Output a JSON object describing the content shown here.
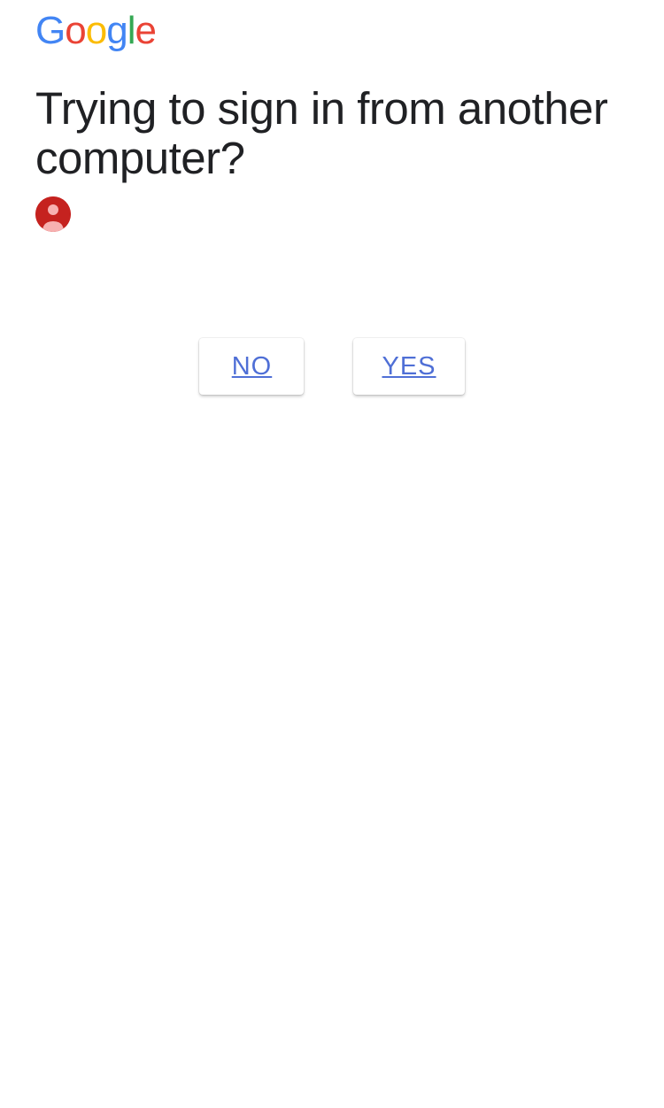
{
  "logo": {
    "g1": "G",
    "o1": "o",
    "o2": "o",
    "g2": "g",
    "l": "l",
    "e": "e"
  },
  "heading": "Trying to sign in from another computer?",
  "account": {
    "email": ""
  },
  "buttons": {
    "no": "NO",
    "yes": "YES"
  },
  "colors": {
    "google_blue": "#4285F4",
    "google_red": "#EA4335",
    "google_yellow": "#FBBC05",
    "google_green": "#34A853",
    "link_blue": "#4F6FD6",
    "avatar_bg": "#C5221F"
  }
}
